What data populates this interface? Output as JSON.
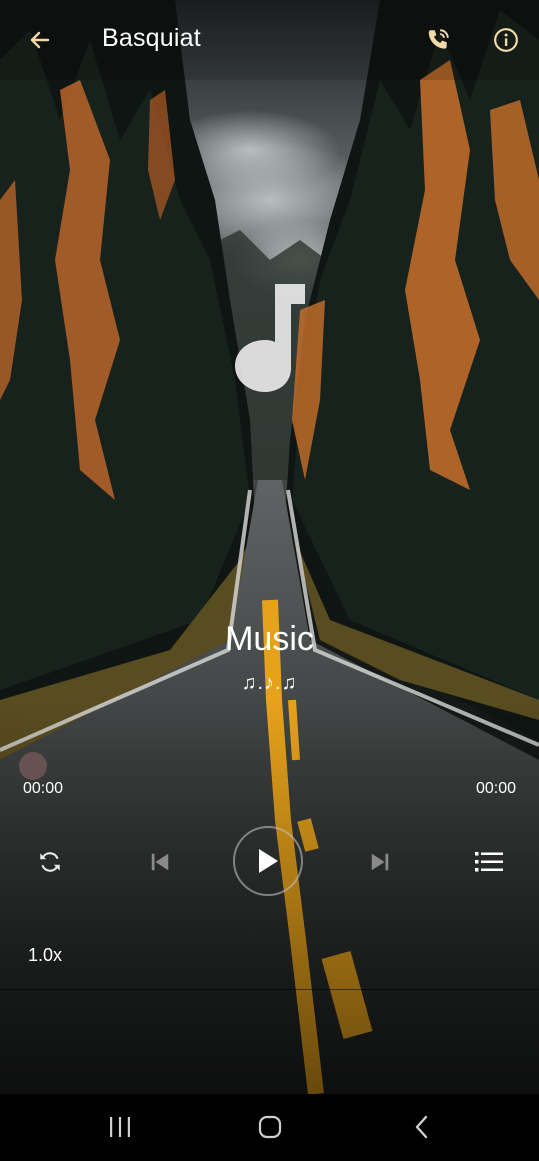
{
  "header": {
    "title": "Basquiat",
    "back_icon": "arrow-left-icon",
    "call_icon": "phone-call-icon",
    "info_icon": "info-icon"
  },
  "track": {
    "title": "Music",
    "subtitle": "♫.♪.♫",
    "art_icon": "music-note-icon"
  },
  "progress": {
    "elapsed": "00:00",
    "duration": "00:00",
    "position_fraction": 0
  },
  "controls": {
    "repeat_icon": "repeat-icon",
    "previous_icon": "skip-previous-icon",
    "play_icon": "play-icon",
    "next_icon": "skip-next-icon",
    "queue_icon": "queue-list-icon",
    "speed": "1.0x"
  },
  "system_nav": {
    "recents_icon": "recents-icon",
    "home_icon": "home-icon",
    "back_icon": "back-chevron-icon"
  },
  "colors": {
    "text": "#ffffff",
    "icon_accent": "#f3d9a8",
    "road_line": "#e7a21b",
    "foliage_orange": "#c9702c",
    "navbar": "#000000"
  }
}
